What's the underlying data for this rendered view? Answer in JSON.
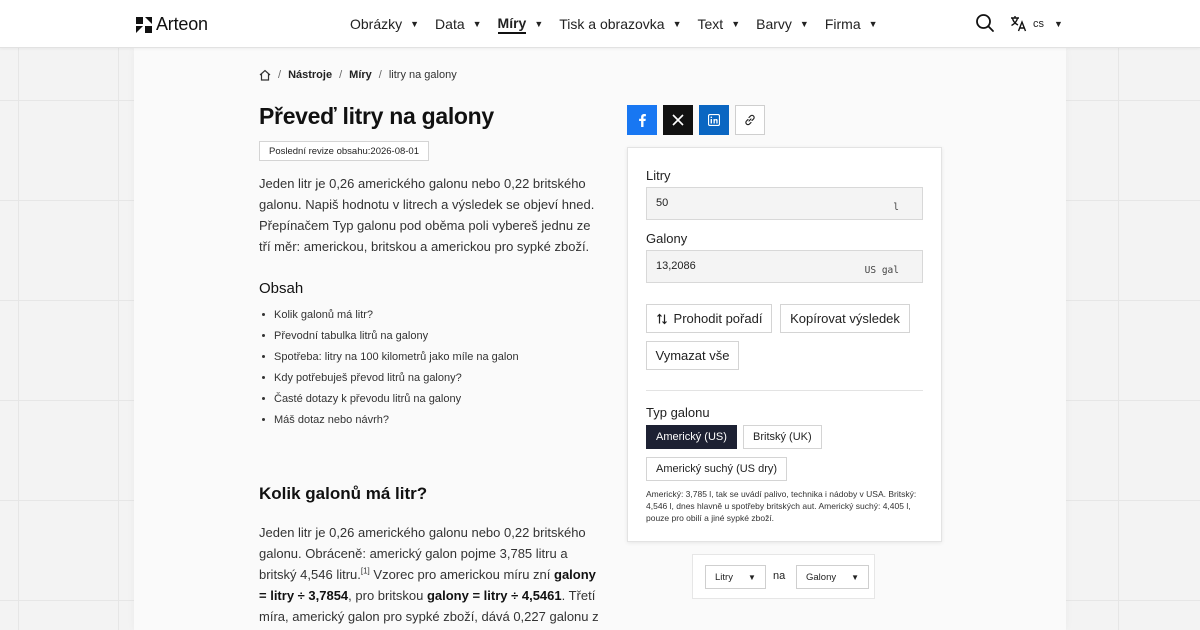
{
  "header": {
    "brand": "Arteon",
    "nav": [
      {
        "label": "Obrázky",
        "active": false
      },
      {
        "label": "Data",
        "active": false
      },
      {
        "label": "Míry",
        "active": true
      },
      {
        "label": "Tisk a obrazovka",
        "active": false
      },
      {
        "label": "Text",
        "active": false
      },
      {
        "label": "Barvy",
        "active": false
      },
      {
        "label": "Firma",
        "active": false
      }
    ],
    "search_icon": "search-icon",
    "language": "cs",
    "language_icon": "translate-icon"
  },
  "breadcrumb": {
    "home_icon": "home-icon",
    "items": [
      "Nástroje",
      "Míry"
    ],
    "current": "litry na galony"
  },
  "page": {
    "title": "Převeď litry na galony",
    "revision_label": "Poslední revize obsahu:",
    "revision_date": "2026-08-01",
    "intro": "Jeden litr je 0,26 amerického galonu nebo 0,22 britského galonu. Napiš hodnotu v litrech a výsledek se objeví hned. Přepínačem Typ galonu pod oběma poli vybereš jednu ze tří měr: americkou, britskou a americkou pro sypké zboží."
  },
  "toc": {
    "title": "Obsah",
    "items": [
      "Kolik galonů má litr?",
      "Převodní tabulka litrů na galony",
      "Spotřeba: litry na 100 kilometrů jako míle na galon",
      "Kdy potřebuješ převod litrů na galony?",
      "Časté dotazy k převodu litrů na galony",
      "Máš dotaz nebo návrh?"
    ]
  },
  "section": {
    "title": "Kolik galonů má litr?",
    "p1": "Jeden litr je 0,26 amerického galonu nebo 0,22 britského galonu. Obráceně: americký galon pojme 3,785 litru a britský 4,546 litru.",
    "footnote": "[1]",
    "p2": " Vzorec pro americkou míru zní ",
    "formula_us": "galony = litry ÷ 3,7854",
    "p3": ", pro britskou ",
    "formula_uk": "galony = litry ÷ 4,5461",
    "p4": ". Třetí míra, americký galon pro sypké zboží, dává 0,227 galonu z"
  },
  "share": {
    "facebook_icon": "facebook-icon",
    "x_icon": "x-icon",
    "linkedin_icon": "linkedin-icon",
    "link_icon": "link-icon"
  },
  "converter": {
    "liters_label": "Litry",
    "liters_value": "50",
    "liters_unit": "l",
    "gallons_label": "Galony",
    "gallons_value": "13,2086",
    "gallons_unit": "US gal",
    "swap_label": "Prohodit pořadí",
    "copy_label": "Kopírovat výsledek",
    "clear_label": "Vymazat vše",
    "type_label": "Typ galonu",
    "types": [
      {
        "label": "Americký (US)",
        "selected": true
      },
      {
        "label": "Britský (UK)",
        "selected": false
      },
      {
        "label": "Americký suchý (US dry)",
        "selected": false
      }
    ],
    "note": "Americký: 3,785 l, tak se uvádí palivo, technika i nádoby v USA. Britský: 4,546 l, dnes hlavně u spotřeby britských aut. Americký suchý: 4,405 l, pouze pro obilí a jiné sypké zboží."
  },
  "unit_selector": {
    "from": "Litry",
    "separator": "na",
    "to": "Galony"
  },
  "colors": {
    "selected_chip": "#1d2133",
    "facebook": "#1877f2",
    "x": "#111111",
    "linkedin": "#0a66c2"
  }
}
